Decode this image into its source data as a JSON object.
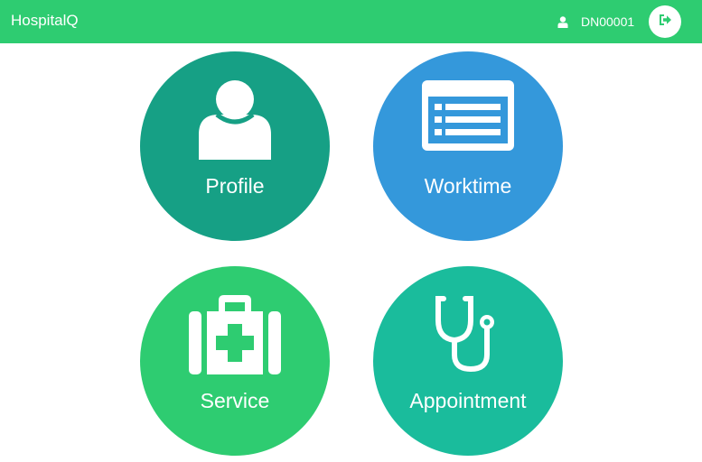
{
  "navbar": {
    "brand": "HospitalQ",
    "user_id": "DN00001",
    "user_icon": "user-icon",
    "logout_icon": "sign-out-icon",
    "color": "#2ecc71"
  },
  "tiles": [
    {
      "label": "Profile",
      "icon": "user-icon",
      "color": "#16a085"
    },
    {
      "label": "Worktime",
      "icon": "list-icon",
      "color": "#3498db"
    },
    {
      "label": "Service",
      "icon": "medkit-icon",
      "color": "#2ecc71"
    },
    {
      "label": "Appointment",
      "icon": "stethoscope-icon",
      "color": "#1abc9c"
    }
  ]
}
